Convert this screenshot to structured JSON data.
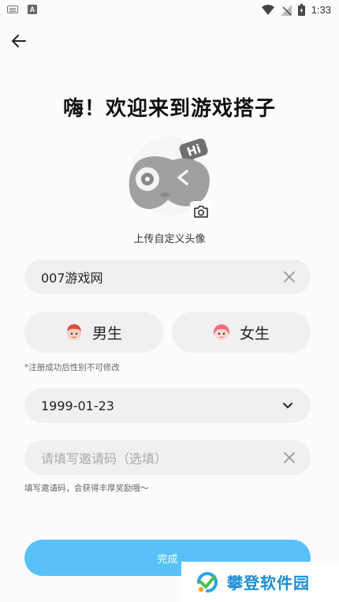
{
  "status_bar": {
    "time": "1:33"
  },
  "page": {
    "title": "嗨！欢迎来到游戏搭子",
    "avatar_label": "上传自定义头像"
  },
  "form": {
    "nickname": {
      "value": "007游戏网"
    },
    "gender": {
      "male_label": "男生",
      "female_label": "女生"
    },
    "gender_hint": "*注册成功后性别不可修改",
    "birthday": {
      "value": "1999-01-23"
    },
    "invite_code": {
      "placeholder": "请填写邀请码（选填）"
    },
    "invite_hint": "填写邀请码，会获得丰厚奖励哦～",
    "submit_label": "完成"
  },
  "watermark": {
    "text": "攀登软件园"
  },
  "icons": {
    "back": "arrow-left-icon",
    "camera": "camera-icon",
    "clear": "close-icon",
    "chevron": "chevron-down-icon",
    "wifi": "wifi-icon",
    "signal": "signal-icon",
    "battery": "battery-icon"
  },
  "colors": {
    "accent": "#58c2f8",
    "field_bg": "#f1eff2"
  }
}
